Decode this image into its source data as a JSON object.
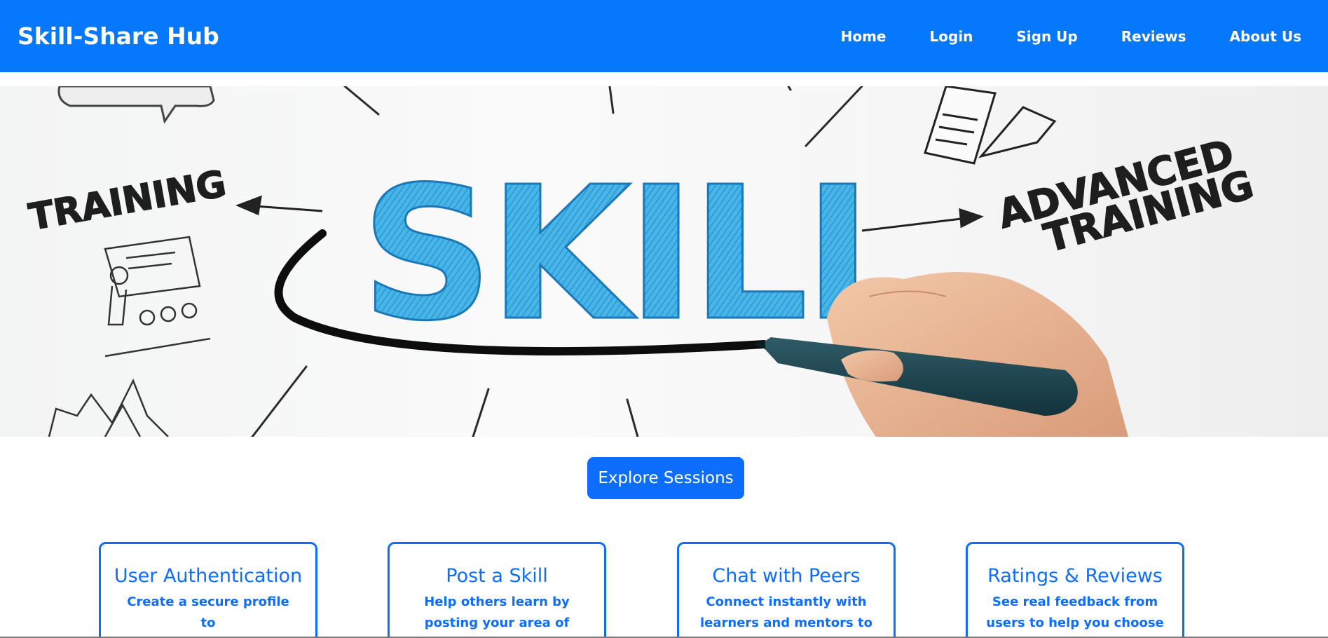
{
  "navbar": {
    "brand": "Skill-Share Hub",
    "links": [
      "Home",
      "Login",
      "Sign Up",
      "Reviews",
      "About Us"
    ],
    "bg_color": "#0578fe"
  },
  "hero": {
    "words": {
      "skill": "SKILL",
      "training": "TRAINING",
      "advanced_line1": "ADVANCED",
      "advanced_line2": "TRAINING"
    },
    "accent_color": "#3aa8dd"
  },
  "cta": {
    "label": "Explore Sessions",
    "color": "#0d6efd"
  },
  "features": [
    {
      "title": "User Authentication",
      "text": "Create a secure profile to"
    },
    {
      "title": "Post a Skill",
      "text": "Help others learn by posting your area of"
    },
    {
      "title": "Chat with Peers",
      "text": "Connect instantly with learners and mentors to"
    },
    {
      "title": "Ratings & Reviews",
      "text": "See real feedback from users to help you choose"
    }
  ]
}
